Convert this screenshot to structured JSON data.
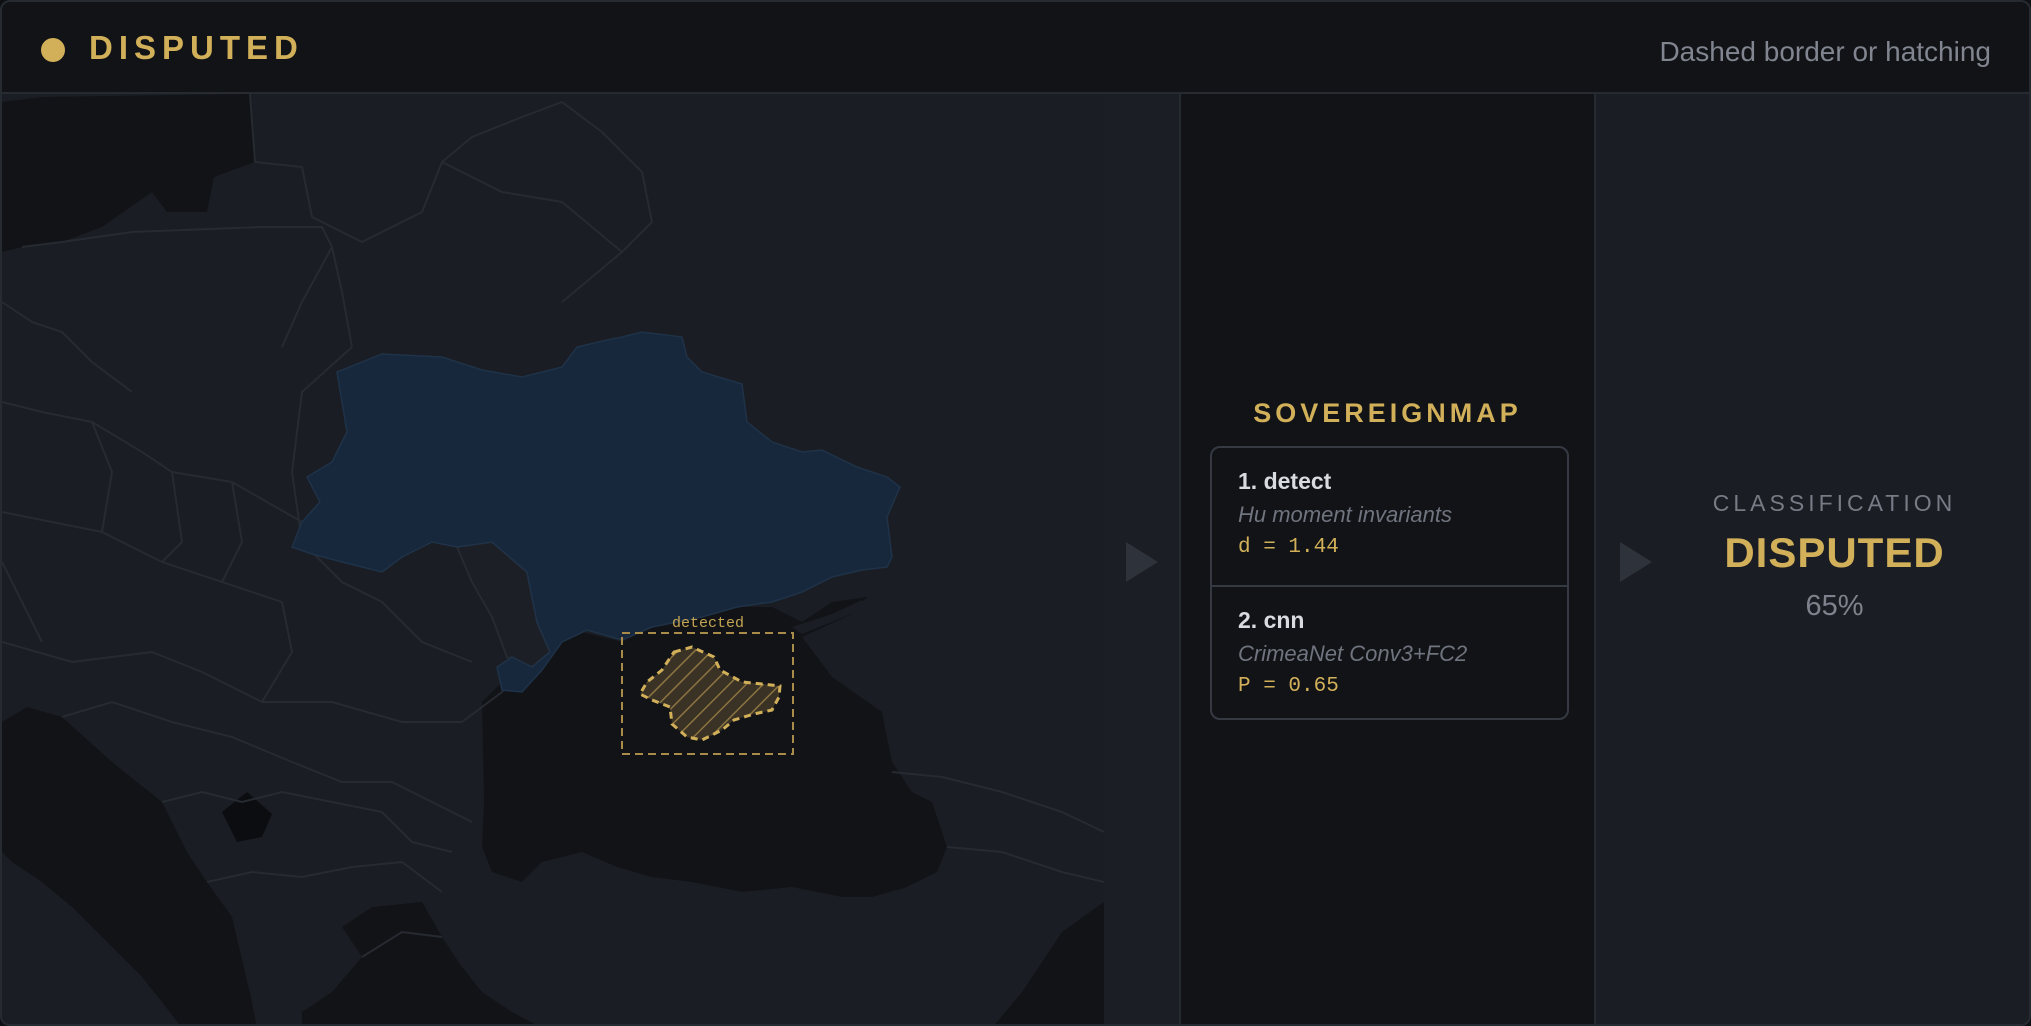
{
  "header": {
    "status_title": "DISPUTED",
    "hint": "Dashed border or hatching"
  },
  "map": {
    "detection_label": "detected"
  },
  "model": {
    "title": "SOVEREIGNMAP",
    "steps": [
      {
        "name": "1. detect",
        "description": "Hu moment invariants",
        "metric": "d = 1.44"
      },
      {
        "name": "2. cnn",
        "description": "CrimeaNet Conv3+FC2",
        "metric": "P = 0.65"
      }
    ]
  },
  "result": {
    "label": "CLASSIFICATION",
    "value": "DISPUTED",
    "confidence": "65%"
  },
  "colors": {
    "accent": "#d2b059",
    "land": "#1a1d23",
    "sea": "#111317",
    "highlight_country": "#17283c",
    "border": "#262a31"
  }
}
